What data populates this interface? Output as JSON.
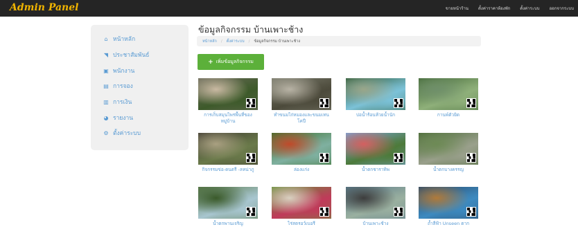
{
  "header": {
    "brand": "Admin Panel",
    "nav": [
      "ขายหน้าร้าน",
      "ตั้งค่าราคาห้องพัก",
      "ตั้งค่าระบบ",
      "ออกจากระบบ"
    ]
  },
  "sidebar": {
    "items": [
      {
        "label": "หน้าหลัก",
        "icon": "home-icon",
        "glyph": "⌂"
      },
      {
        "label": "ประชาสัมพันธ์",
        "icon": "rss-icon",
        "glyph": "◥"
      },
      {
        "label": "พนักงาน",
        "icon": "staff-icon",
        "glyph": "▣"
      },
      {
        "label": "การจอง",
        "icon": "booking-icon",
        "glyph": "▤"
      },
      {
        "label": "การเงิน",
        "icon": "finance-icon",
        "glyph": "▥"
      },
      {
        "label": "รายงาน",
        "icon": "report-icon",
        "glyph": "◕"
      },
      {
        "label": "ตั้งค่าระบบ",
        "icon": "settings-icon",
        "glyph": "⚙"
      }
    ]
  },
  "main": {
    "title": "ข้อมูลกิจกรรม บ้านเพาะช้าง",
    "breadcrumb": [
      "หน้าหลัก",
      "ตั้งค่าระบบ",
      "ข้อมูลกิจกรรม บ้านเพาะช้าง"
    ],
    "add_button": "เพิ่มข้อมูลกิจกรรม",
    "activities": [
      {
        "caption": "การเก็บสมุนไพรพื้นที่ของหมู่บ้าน",
        "palette": [
          "#6b6a5a",
          "#3d5a2a",
          "#c9b9a2"
        ]
      },
      {
        "caption": "ทำขนมไก่หมองและขนมเทนโคปี",
        "palette": [
          "#7a7b6c",
          "#4c4a3b",
          "#b8b3a5"
        ]
      },
      {
        "caption": "บ่อน้ำร้อนห้วยน้ำนัก",
        "palette": [
          "#2f5d3a",
          "#7cc2d8",
          "#9aa68a"
        ]
      },
      {
        "caption": "กานพ์ตัวยิด",
        "palette": [
          "#466b3a",
          "#8fb07a",
          "#6f8f6a"
        ]
      },
      {
        "caption": "กิจกรรมข่อ-ดนตรี -ลหน่าภู",
        "palette": [
          "#3e3a30",
          "#6a7a4a",
          "#a9a081"
        ]
      },
      {
        "caption": "ล่องแก่ง",
        "palette": [
          "#3c6f2c",
          "#7fb0a0",
          "#c04a2a"
        ]
      },
      {
        "caption": "น้ำตกชาราทิพ",
        "palette": [
          "#79a7d9",
          "#4d7a3a",
          "#d46060"
        ]
      },
      {
        "caption": "น้ำตกบางครรญ",
        "palette": [
          "#4d6b3a",
          "#9aa08c",
          "#6d8a55"
        ]
      },
      {
        "caption": "น้ำตกพานเจริญ",
        "palette": [
          "#5a7a4a",
          "#a8c6d0",
          "#3a5a2a"
        ]
      },
      {
        "caption": "ไร่สตรอว์เบอรี",
        "palette": [
          "#6a8f3a",
          "#c03a5a",
          "#d9d0c0"
        ]
      },
      {
        "caption": "บ้านเพาะช้าง",
        "palette": [
          "#5a7a8a",
          "#9ab0a0",
          "#3d3d3d"
        ]
      },
      {
        "caption": "ถ้ำสีฟ้า Unseen ตาก",
        "palette": [
          "#2a4a6a",
          "#3d8ac0",
          "#b07a3a"
        ]
      }
    ]
  },
  "colors": {
    "topbar": "#252525",
    "brand": "#f0b400",
    "link": "#5a9bd3",
    "button": "#5cb03a",
    "sidebar_bg": "#f0f0f0"
  }
}
